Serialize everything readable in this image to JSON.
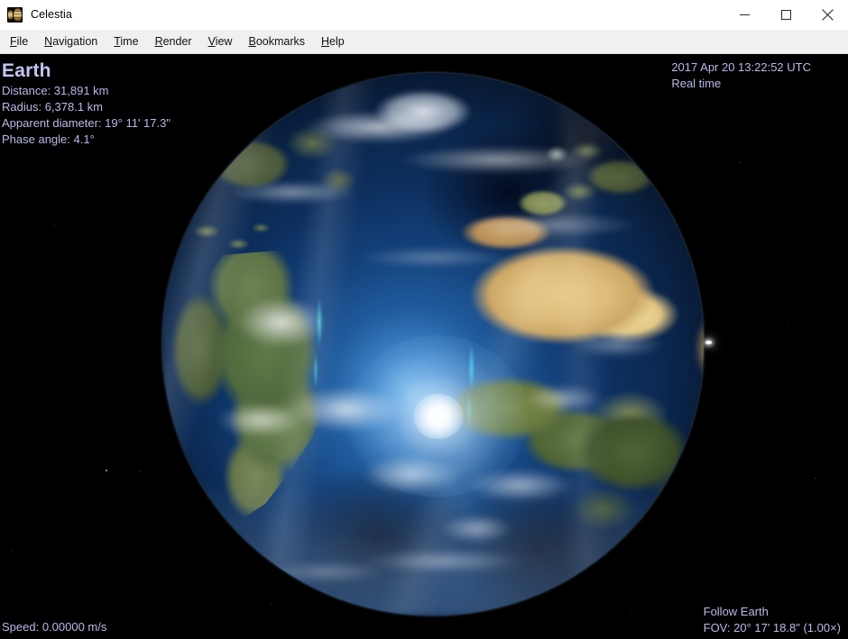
{
  "window": {
    "title": "Celestia",
    "icon": "celestia-planet-icon",
    "controls": {
      "minimize": "minimize-icon",
      "maximize": "maximize-icon",
      "close": "close-icon"
    }
  },
  "menubar": {
    "items": [
      {
        "label": "File",
        "mnemonic": "F",
        "before": "",
        "after": "ile"
      },
      {
        "label": "Navigation",
        "mnemonic": "N",
        "before": "",
        "after": "avigation"
      },
      {
        "label": "Time",
        "mnemonic": "T",
        "before": "",
        "after": "ime"
      },
      {
        "label": "Render",
        "mnemonic": "R",
        "before": "",
        "after": "ender"
      },
      {
        "label": "View",
        "mnemonic": "V",
        "before": "",
        "after": "iew"
      },
      {
        "label": "Bookmarks",
        "mnemonic": "B",
        "before": "",
        "after": "ookmarks"
      },
      {
        "label": "Help",
        "mnemonic": "H",
        "before": "",
        "after": "elp"
      }
    ]
  },
  "viewport": {
    "background_color": "#000000",
    "rendered_object": "Earth",
    "overlay_text_color": "#b9b9e9"
  },
  "hud": {
    "object_info": {
      "name": "Earth",
      "distance": "Distance: 31,891 km",
      "radius": "Radius: 6,378.1 km",
      "apparent_diameter": "Apparent diameter: 19° 11' 17.3\"",
      "phase_angle": "Phase angle: 4.1°"
    },
    "time_info": {
      "datetime": "2017 Apr 20 13:22:52 UTC",
      "rate": "Real time"
    },
    "speed": "Speed: 0.00000 m/s",
    "camera": {
      "mode": "Follow Earth",
      "fov": "FOV: 20° 17' 18.8\" (1.00×)"
    }
  }
}
